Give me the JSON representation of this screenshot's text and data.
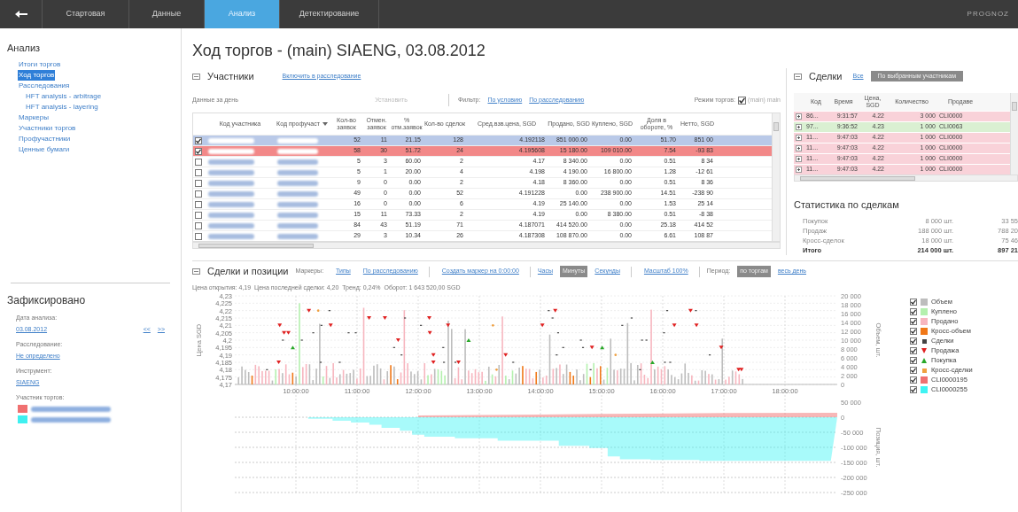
{
  "nav": {
    "tabs": [
      {
        "label": "Стартовая",
        "selected": false
      },
      {
        "label": "Данные",
        "selected": false
      },
      {
        "label": "Анализ",
        "selected": true
      },
      {
        "label": "Детектирование",
        "selected": false
      }
    ],
    "brand": "PROGNOZ"
  },
  "sidebar": {
    "title": "Анализ",
    "items": [
      {
        "label": "Итоги торгов",
        "selected": false
      },
      {
        "label": "Ход торгов",
        "selected": true
      },
      {
        "label": "Расследования",
        "selected": false,
        "children": [
          {
            "label": "HFT analysis - arbitrage",
            "selected": false
          },
          {
            "label": "HFT analysis - layering",
            "selected": false
          }
        ]
      },
      {
        "label": "Маркеры",
        "selected": false
      },
      {
        "label": "Участники торгов",
        "selected": false
      },
      {
        "label": "Профучастники",
        "selected": false
      },
      {
        "label": "Ценные бумаги",
        "selected": false
      }
    ],
    "fixed": {
      "title": "Зафиксировано",
      "date_label": "Дата анализа:",
      "date": "03.08.2012",
      "prev": "<<",
      "next": ">>",
      "investigation_label": "Расследование:",
      "investigation": "Не определено",
      "instrument_label": "Инструмент:",
      "instrument": "SIAENG",
      "traders_label": "Участник торгов:",
      "traders": [
        {
          "color": "#f07070"
        },
        {
          "color": "#3ff0f0"
        }
      ]
    }
  },
  "title": "Ход торгов - (main) SIAENG, 03.08.2012",
  "participants": {
    "title": "Участники",
    "include_link": "Включить в расследование",
    "day_label": "Данные за день",
    "set_button": "Установить",
    "filter_label": "Фильтр:",
    "filter_links": [
      "По условию",
      "По расследованию"
    ],
    "mode_label": "Режим торгов:",
    "mode": {
      "label": "(main) main",
      "checked": true
    },
    "columns": [
      {
        "label": "Код участника",
        "sorted": false
      },
      {
        "label": "Код профучаст",
        "sorted": true
      },
      {
        "label": "Кол-во заявок",
        "sorted": false
      },
      {
        "label": "Отмен. заявок",
        "sorted": false
      },
      {
        "label": "% отм.заявок",
        "sorted": false
      },
      {
        "label": "Кол-во сделок",
        "sorted": false
      },
      {
        "label": "Сред.взв.цена, SGD",
        "sorted": false
      },
      {
        "label": "Продано, SGD",
        "sorted": false
      },
      {
        "label": "Куплено, SGD",
        "sorted": false
      },
      {
        "label": "Доля в обороте, %",
        "sorted": false
      },
      {
        "label": "Нетто, SGD",
        "sorted": false
      }
    ],
    "rows": [
      {
        "checked": true,
        "color": "#b9c9e8",
        "cells": [
          "",
          "",
          "52",
          "11",
          "21.15",
          "128",
          "4.192118",
          "851 000.00",
          "0.00",
          "51.70",
          "851 00"
        ]
      },
      {
        "checked": true,
        "color": "#f28888",
        "cells": [
          "",
          "",
          "58",
          "30",
          "51.72",
          "24",
          "4.195608",
          "15 180.00",
          "109 010.00",
          "7.54",
          "-93 83"
        ]
      },
      {
        "checked": false,
        "cells": [
          "",
          "",
          "5",
          "3",
          "60.00",
          "2",
          "4.17",
          "8 340.00",
          "0.00",
          "0.51",
          "8 34"
        ]
      },
      {
        "checked": false,
        "cells": [
          "",
          "",
          "5",
          "1",
          "20.00",
          "4",
          "4.198",
          "4 190.00",
          "16 800.00",
          "1.28",
          "-12 61"
        ]
      },
      {
        "checked": false,
        "cells": [
          "",
          "",
          "9",
          "0",
          "0.00",
          "2",
          "4.18",
          "8 360.00",
          "0.00",
          "0.51",
          "8 36"
        ]
      },
      {
        "checked": false,
        "cells": [
          "",
          "",
          "49",
          "0",
          "0.00",
          "52",
          "4.191228",
          "0.00",
          "238 900.00",
          "14.51",
          "-238 90"
        ]
      },
      {
        "checked": false,
        "cells": [
          "",
          "",
          "16",
          "0",
          "0.00",
          "6",
          "4.19",
          "25 140.00",
          "0.00",
          "1.53",
          "25 14"
        ]
      },
      {
        "checked": false,
        "cells": [
          "",
          "",
          "15",
          "11",
          "73.33",
          "2",
          "4.19",
          "0.00",
          "8 380.00",
          "0.51",
          "-8 38"
        ]
      },
      {
        "checked": false,
        "cells": [
          "",
          "",
          "84",
          "43",
          "51.19",
          "71",
          "4.187071",
          "414 520.00",
          "0.00",
          "25.18",
          "414 52"
        ]
      },
      {
        "checked": false,
        "cells": [
          "",
          "",
          "29",
          "3",
          "10.34",
          "26",
          "4.187308",
          "108 870.00",
          "0.00",
          "6.61",
          "108 87"
        ]
      }
    ]
  },
  "deals": {
    "title": "Сделки",
    "all_link": "Все",
    "filter_button": {
      "label": "По выбранным участникам",
      "selected": true
    },
    "columns": [
      "Код",
      "Время",
      "Цена, SGD",
      "Количество",
      "Продаве"
    ],
    "rows": [
      {
        "color": "#f9d2d9",
        "cells": [
          "86...",
          "9:31:57",
          "4.22",
          "3 000",
          "CLI0000"
        ]
      },
      {
        "color": "#daf0d2",
        "cells": [
          "97...",
          "9:36:52",
          "4.23",
          "1 000",
          "CLI0063"
        ]
      },
      {
        "color": "#f9d2d9",
        "cells": [
          "11...",
          "9:47:03",
          "4.22",
          "1 000",
          "CLI0000"
        ]
      },
      {
        "color": "#f9d2d9",
        "cells": [
          "11...",
          "9:47:03",
          "4.22",
          "1 000",
          "CLI0000"
        ]
      },
      {
        "color": "#f9d2d9",
        "cells": [
          "11...",
          "9:47:03",
          "4.22",
          "1 000",
          "CLI0000"
        ]
      },
      {
        "color": "#f9d2d9",
        "cells": [
          "11...",
          "9:47:03",
          "4.22",
          "1 000",
          "CLI0000"
        ]
      }
    ]
  },
  "stats": {
    "title": "Статистика по сделкам",
    "rows": [
      {
        "kind": "normal",
        "cells": [
          "Покупок",
          "8 000 шт.",
          "33 55"
        ]
      },
      {
        "kind": "normal",
        "cells": [
          "Продаж",
          "188 000 шт.",
          "788 20"
        ]
      },
      {
        "kind": "normal",
        "cells": [
          "Кросс-сделок",
          "18 000 шт.",
          "75 46"
        ]
      },
      {
        "kind": "total",
        "cells": [
          "Итого",
          "214 000 шт.",
          "897 21"
        ]
      }
    ]
  },
  "positions": {
    "title": "Сделки и позиции",
    "toolbar": [
      {
        "kind": "label",
        "text": "Маркеры:"
      },
      {
        "kind": "link",
        "text": "Типы"
      },
      {
        "kind": "link",
        "text": "По расследованию"
      },
      {
        "kind": "separator"
      },
      {
        "kind": "link",
        "text": "Создать маркер на 0:00:00"
      },
      {
        "kind": "separator"
      },
      {
        "kind": "toggle",
        "text": "Часы",
        "selected": false
      },
      {
        "kind": "toggle",
        "text": "Минуты",
        "selected": true
      },
      {
        "kind": "toggle",
        "text": "Секунды",
        "selected": false
      },
      {
        "kind": "separator"
      },
      {
        "kind": "link",
        "text": "Масштаб 100%"
      },
      {
        "kind": "separator"
      },
      {
        "kind": "label",
        "text": "Период:"
      },
      {
        "kind": "toggle",
        "text": "по торгам",
        "selected": true
      },
      {
        "kind": "toggle",
        "text": "весь день",
        "selected": false
      }
    ],
    "info": "Цена открытия: 4,19  Цена последней сделки: 4,20  Тренд: 0,24%  Оборот: 1 643 520,00 SGD",
    "price_axis": {
      "title": "Цена SGD",
      "ticks": [
        "4,23",
        "4,225",
        "4,22",
        "4,215",
        "4,21",
        "4,205",
        "4,2",
        "4,195",
        "4,19",
        "4,185",
        "4,18",
        "4,175",
        "4,17"
      ]
    },
    "volume_axis": {
      "title": "Объем, шт.",
      "ticks": [
        "20 000",
        "18 000",
        "16 000",
        "14 000",
        "12 000",
        "10 000",
        "8 000",
        "6 000",
        "4 000",
        "2 000",
        "0"
      ]
    },
    "position_axis": {
      "title": "Позиция, шт.",
      "ticks": [
        "50 000",
        "0",
        "-50 000",
        "-100 000",
        "-150 000",
        "-200 000",
        "-250 000"
      ]
    },
    "time_ticks": [
      "10:00:00",
      "11:00:00",
      "12:00:00",
      "13:00:00",
      "14:00:00",
      "15:00:00",
      "16:00:00",
      "17:00:00",
      "18:00:00"
    ],
    "legend": [
      {
        "kind": "swatch",
        "label": "Объем",
        "checked": true,
        "color": "#bdbdbd"
      },
      {
        "kind": "swatch",
        "label": "Куплено",
        "checked": true,
        "color": "#b4f0ae"
      },
      {
        "kind": "swatch",
        "label": "Продано",
        "checked": true,
        "color": "#f7b6bf"
      },
      {
        "kind": "swatch",
        "label": "Кросс-объем",
        "checked": true,
        "color": "#f07818"
      },
      {
        "kind": "dot",
        "label": "Сделки",
        "checked": true,
        "color": "#444444"
      },
      {
        "kind": "sell",
        "label": "Продажа",
        "checked": true,
        "color": "#e02020"
      },
      {
        "kind": "buy",
        "label": "Покупка",
        "checked": true,
        "color": "#28a828"
      },
      {
        "kind": "cross",
        "label": "Кросс-сделки",
        "checked": true,
        "color": "#f0a040"
      },
      {
        "kind": "participant",
        "label": "CLI0000195",
        "checked": true,
        "color": "#f07070"
      },
      {
        "kind": "participant",
        "label": "CLI0000255",
        "checked": true,
        "color": "#3ff3f3"
      }
    ]
  }
}
